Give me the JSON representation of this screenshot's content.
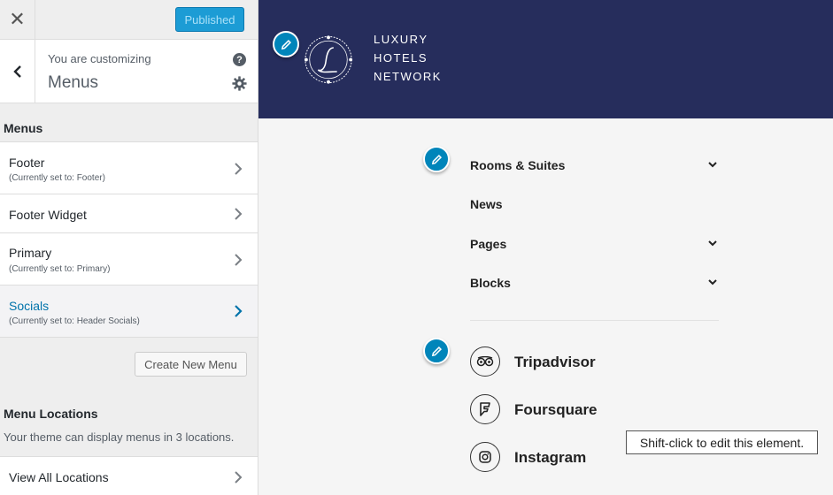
{
  "topbar": {
    "close_symbol": "✕",
    "publish_label": "Published"
  },
  "section": {
    "customizing_label": "You are customizing",
    "title": "Menus",
    "help_symbol": "?"
  },
  "menus": {
    "group_title": "Menus",
    "items": [
      {
        "label": "Footer",
        "sub": "(Currently set to: Footer)"
      },
      {
        "label": "Footer Widget",
        "sub": ""
      },
      {
        "label": "Primary",
        "sub": "(Currently set to: Primary)"
      },
      {
        "label": "Socials",
        "sub": "(Currently set to: Header Socials)"
      }
    ],
    "create_label": "Create New Menu"
  },
  "locations": {
    "title": "Menu Locations",
    "description": "Your theme can display menus in 3 locations.",
    "view_all_label": "View All Locations"
  },
  "preview": {
    "logo_line1": "LUXURY",
    "logo_line2": "HOTELS",
    "logo_line3": "NETWORK",
    "nav": [
      {
        "label": "Rooms & Suites",
        "has_submenu": true
      },
      {
        "label": "News",
        "has_submenu": false
      },
      {
        "label": "Pages",
        "has_submenu": true
      },
      {
        "label": "Blocks",
        "has_submenu": true
      }
    ],
    "socials": [
      {
        "label": "Tripadvisor",
        "icon": "tripadvisor-icon"
      },
      {
        "label": "Foursquare",
        "icon": "foursquare-icon"
      },
      {
        "label": "Instagram",
        "icon": "instagram-icon"
      }
    ]
  },
  "tooltip": {
    "text": "Shift-click to edit this element."
  },
  "colors": {
    "header_bg": "#262d5c",
    "accent": "#0085ba",
    "publish_bg": "#1c9cd5",
    "active_link": "#0073aa"
  }
}
